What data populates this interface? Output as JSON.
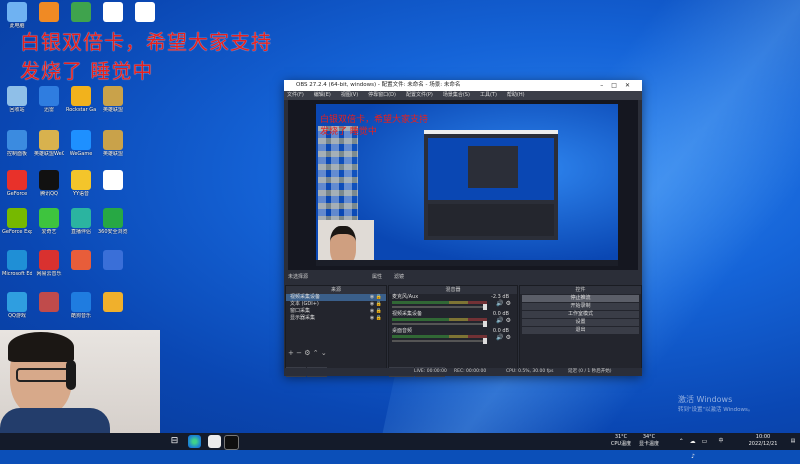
{
  "overlay": {
    "line1": "白银双倍卡，希望大家支持",
    "line2": "发烧了 睡觉中"
  },
  "desktop_icons": [
    {
      "label": "此电脑",
      "color": "#6fb2f2"
    },
    {
      "label": "",
      "color": "#f08a24"
    },
    {
      "label": "",
      "color": "#3fa34d"
    },
    {
      "label": "",
      "color": "#ffffff"
    },
    {
      "label": "",
      "color": "#ffffff"
    },
    {
      "label": "回收站",
      "color": "#8fbfe8"
    },
    {
      "label": "迅雷",
      "color": "#2f7de0"
    },
    {
      "label": "Rockstar Games",
      "color": "#f2b21c"
    },
    {
      "label": "英雄联盟",
      "color": "#c9a24a"
    },
    {
      "label": "控制面板",
      "color": "#3b8be0"
    },
    {
      "label": "英雄联盟WeGame版",
      "color": "#d8b24e"
    },
    {
      "label": "WeGame",
      "color": "#1e90ff"
    },
    {
      "label": "英雄联盟",
      "color": "#c9a24a"
    },
    {
      "label": "GeForce",
      "color": "#e8312a"
    },
    {
      "label": "腾讯QQ",
      "color": "#111111"
    },
    {
      "label": "YY语音",
      "color": "#f3c52b"
    },
    {
      "label": "",
      "color": "#ffffff"
    },
    {
      "label": "GeForce Experience",
      "color": "#76b900"
    },
    {
      "label": "爱奇艺",
      "color": "#3ec43e"
    },
    {
      "label": "直播伴侣",
      "color": "#2bb4a0"
    },
    {
      "label": "360安全浏览器",
      "color": "#27a844"
    },
    {
      "label": "Microsoft Edge",
      "color": "#1f8fd6"
    },
    {
      "label": "网易云音乐",
      "color": "#d9312f"
    },
    {
      "label": "",
      "color": "#e85d3a"
    },
    {
      "label": "",
      "color": "#3a6fd8"
    },
    {
      "label": "QQ游戏",
      "color": "#2f9ee0"
    },
    {
      "label": "",
      "color": "#c04b4b"
    },
    {
      "label": "酷狗音乐",
      "color": "#1f7ce0"
    },
    {
      "label": "",
      "color": "#f0b02c"
    }
  ],
  "obs": {
    "title": "OBS 27.2.4 (64-bit, windows) - 配置文件: 未命名 - 场景: 未命名",
    "menu": [
      "文件(F)",
      "编辑(E)",
      "视图(V)",
      "停靠窗口(D)",
      "配置文件(P)",
      "场景集合(S)",
      "工具(T)",
      "帮助(H)"
    ],
    "no_source": "未选择源",
    "btn_props": "属性",
    "btn_filters": "滤镜",
    "panels": {
      "sources_header": "来源",
      "mixer_header": "混音器",
      "controls_header": "控件"
    },
    "sources": [
      {
        "label": "视频采集设备",
        "selected": true
      },
      {
        "label": "文本 (GDI+)",
        "selected": false
      },
      {
        "label": "窗口采集",
        "selected": false
      },
      {
        "label": "显示器采集",
        "selected": false
      }
    ],
    "source_tabs": [
      "来源",
      "场景"
    ],
    "mixer": [
      {
        "name": "麦克风/Aux",
        "db": "-2.3 dB"
      },
      {
        "name": "视频采集设备",
        "db": "0.0 dB"
      },
      {
        "name": "桌面音频",
        "db": "0.0 dB"
      }
    ],
    "mixer_tabs": [
      "混音器",
      "转场特效"
    ],
    "controls": [
      {
        "label": "停止推流",
        "active": true
      },
      {
        "label": "开始录制",
        "active": false
      },
      {
        "label": "工作室模式",
        "active": false
      },
      {
        "label": "设置",
        "active": false
      },
      {
        "label": "退出",
        "active": false
      }
    ],
    "status": {
      "live": "LIVE: 00:00:00",
      "rec": "REC: 00:00:00",
      "cpu": "CPU: 0.5%, 30.00 fps",
      "delay": "延迟 (0 / 1 秒后开始)"
    }
  },
  "activation": {
    "title": "激活 Windows",
    "subtitle": "转到\"设置\"以激活 Windows。"
  },
  "taskbar": {
    "cpu_temp": "31°C",
    "cpu_label": "CPU温度",
    "gpu_temp": "34°C",
    "gpu_label": "显卡温度",
    "lang": "中",
    "time": "10:00",
    "date": "2022/12/21"
  }
}
